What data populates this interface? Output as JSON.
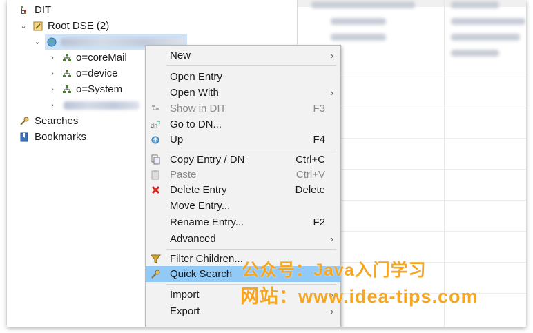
{
  "tree": {
    "dit_label": "DIT",
    "root_dse_label": "Root DSE (2)",
    "entries": [
      {
        "label": "o=coreMail"
      },
      {
        "label": "o=device"
      },
      {
        "label": "o=System"
      }
    ],
    "searches_label": "Searches",
    "bookmarks_label": "Bookmarks"
  },
  "context_menu": {
    "items": [
      {
        "label": "New",
        "shortcut": "",
        "submenu": true,
        "disabled": false,
        "icon": ""
      },
      {
        "label": "Open Entry",
        "shortcut": "",
        "submenu": false,
        "disabled": false,
        "icon": ""
      },
      {
        "label": "Open With",
        "shortcut": "",
        "submenu": true,
        "disabled": false,
        "icon": ""
      },
      {
        "label": "Show in DIT",
        "shortcut": "F3",
        "submenu": false,
        "disabled": true,
        "icon": "show-in-dit-icon"
      },
      {
        "label": "Go to DN...",
        "shortcut": "",
        "submenu": false,
        "disabled": false,
        "icon": "goto-dn-icon"
      },
      {
        "label": "Up",
        "shortcut": "F4",
        "submenu": false,
        "disabled": false,
        "icon": "up-icon"
      },
      {
        "label": "Copy Entry / DN",
        "shortcut": "Ctrl+C",
        "submenu": false,
        "disabled": false,
        "icon": "copy-icon"
      },
      {
        "label": "Paste",
        "shortcut": "Ctrl+V",
        "submenu": false,
        "disabled": true,
        "icon": "paste-icon"
      },
      {
        "label": "Delete Entry",
        "shortcut": "Delete",
        "submenu": false,
        "disabled": false,
        "icon": "delete-icon"
      },
      {
        "label": "Move Entry...",
        "shortcut": "",
        "submenu": false,
        "disabled": false,
        "icon": ""
      },
      {
        "label": "Rename Entry...",
        "shortcut": "F2",
        "submenu": false,
        "disabled": false,
        "icon": ""
      },
      {
        "label": "Advanced",
        "shortcut": "",
        "submenu": true,
        "disabled": false,
        "icon": ""
      },
      {
        "label": "Filter Children...",
        "shortcut": "",
        "submenu": false,
        "disabled": false,
        "icon": "filter-icon"
      },
      {
        "label": "Quick Search",
        "shortcut": "",
        "submenu": false,
        "disabled": false,
        "icon": "quick-search-icon",
        "highlighted": true
      },
      {
        "label": "Import",
        "shortcut": "",
        "submenu": true,
        "disabled": false,
        "icon": ""
      },
      {
        "label": "Export",
        "shortcut": "",
        "submenu": true,
        "disabled": false,
        "icon": ""
      }
    ],
    "submenu_arrow": "›"
  },
  "watermark": {
    "line1": "公众号：Java入门学习",
    "line2": "网站：www.idea-tips.com"
  },
  "colors": {
    "selection": "#cde3f7",
    "menu_highlight": "#91c9f7",
    "watermark": "#f5a623",
    "delete_icon": "#d9261c"
  }
}
